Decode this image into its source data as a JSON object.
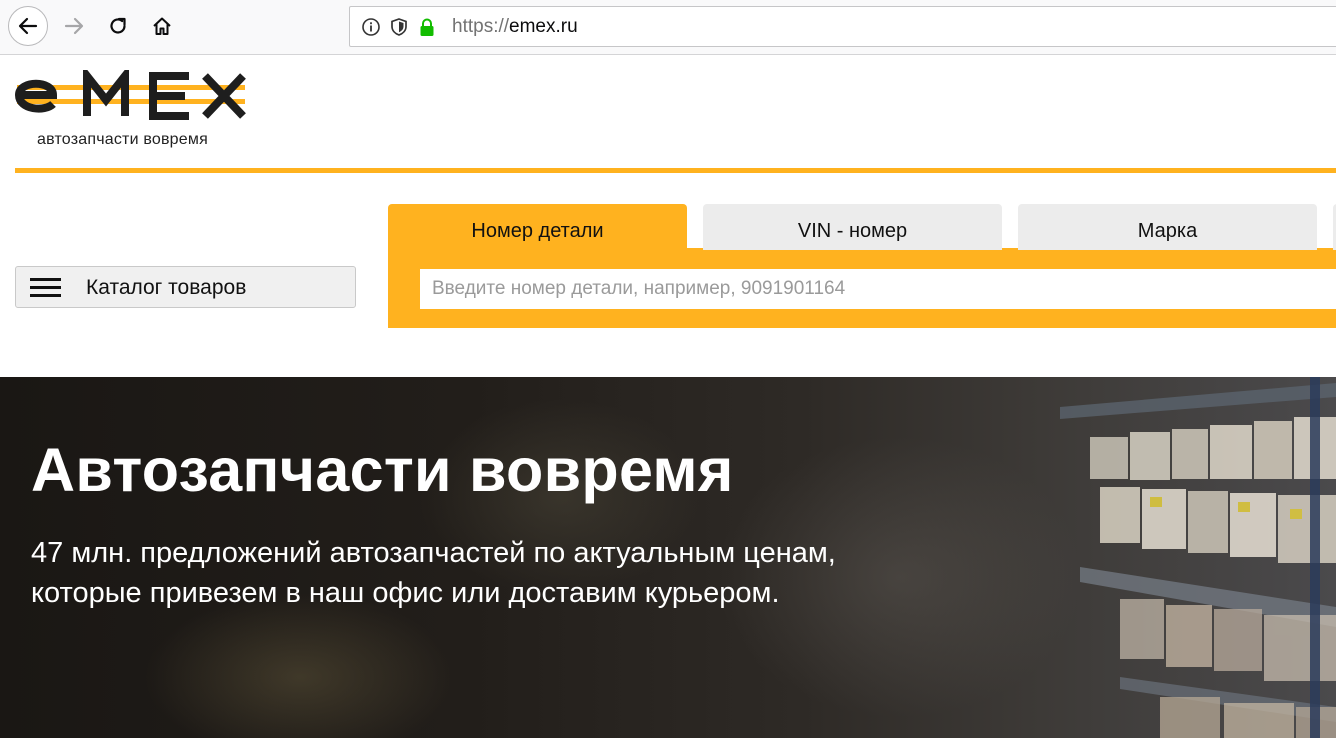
{
  "browser": {
    "url_protocol": "https://",
    "url_host": "emex.ru"
  },
  "header": {
    "logo_text": "eMEX",
    "tagline": "автозапчасти вовремя",
    "accent_color": "#ffb21f"
  },
  "catalog": {
    "label": "Каталог товаров"
  },
  "search": {
    "tabs": [
      {
        "label": "Номер детали",
        "active": true
      },
      {
        "label": "VIN - номер",
        "active": false
      },
      {
        "label": "Марка",
        "active": false
      }
    ],
    "placeholder": "Введите номер детали, например, 9091901164"
  },
  "hero": {
    "title": "Автозапчасти вовремя",
    "subtitle_line1": "47 млн. предложений автозапчастей по актуальным ценам,",
    "subtitle_line2": "которые привезем в наш офис или доставим курьером."
  },
  "icons": [
    "back-arrow-icon",
    "forward-arrow-icon",
    "reload-icon",
    "home-icon",
    "info-icon",
    "shield-icon",
    "lock-icon",
    "hamburger-menu-icon"
  ]
}
